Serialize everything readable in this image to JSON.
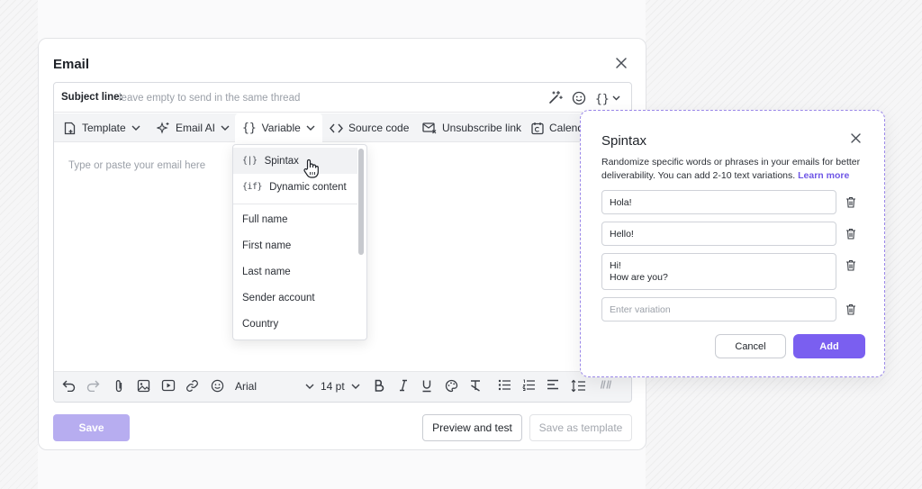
{
  "email": {
    "title": "Email",
    "subject_label": "Subject line:",
    "subject_placeholder": "leave empty to send in the same thread",
    "toolbar": {
      "template": "Template",
      "email_ai": "Email AI",
      "variable": "Variable",
      "source_code": "Source code",
      "unsubscribe": "Unsubscribe link",
      "calendar": "Calend"
    },
    "body_placeholder": "Type or paste your email here",
    "format": {
      "font": "Arial",
      "size": "14 pt"
    },
    "buttons": {
      "save": "Save",
      "preview": "Preview and test",
      "save_template": "Save as template"
    }
  },
  "variable_menu": {
    "special": [
      {
        "icon": "{|}",
        "label": "Spintax"
      },
      {
        "icon": "{if}",
        "label": "Dynamic content"
      }
    ],
    "items": [
      "Full name",
      "First name",
      "Last name",
      "Sender account",
      "Country"
    ]
  },
  "spintax": {
    "title": "Spintax",
    "description": "Randomize specific words or phrases in your emails for better deliverability. You can add 2-10 text variations.",
    "learn_more": "Learn more",
    "variations": [
      {
        "line1": "Hola!",
        "line2": ""
      },
      {
        "line1": "Hello!",
        "line2": ""
      },
      {
        "line1": "Hi!",
        "line2": "How are you?"
      }
    ],
    "new_placeholder": "Enter variation",
    "cancel": "Cancel",
    "add": "Add"
  },
  "colors": {
    "accent": "#7a5ff0",
    "accent_disabled": "#b7adf0",
    "link": "#6f57e6"
  }
}
